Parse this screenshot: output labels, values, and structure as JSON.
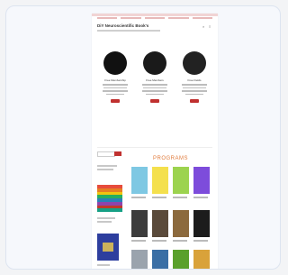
{
  "site": {
    "title": "DiY Neuroscientific Book's",
    "feature_titles": [
      "Free Membership",
      "Free Members",
      "Free Fields"
    ],
    "featured_circles": [
      "#111111",
      "#1a1a1a",
      "#222222"
    ],
    "programs_title": "PROGRAMS"
  },
  "icons": [
    "search-icon",
    "menu-icon"
  ],
  "colors": {
    "accent": "#c0302f",
    "programs_heading": "#e07a3a",
    "top_bar": "#f1d4d4"
  },
  "sidebar": {
    "rainbow": [
      "#e74c3c",
      "#e67e22",
      "#f1c40f",
      "#27ae60",
      "#2980b9",
      "#8e44ad",
      "#c0392b",
      "#16a085"
    ]
  },
  "books": [
    "#7ec8e3",
    "#f4e04d",
    "#9cd34f",
    "#7d4cdb",
    "#3c3c3c",
    "#5a4a3a",
    "#8c6a3d",
    "#1c1c1c",
    "#9aa3ad",
    "#3a6ea5",
    "#5aa02c",
    "#d9a23a"
  ]
}
